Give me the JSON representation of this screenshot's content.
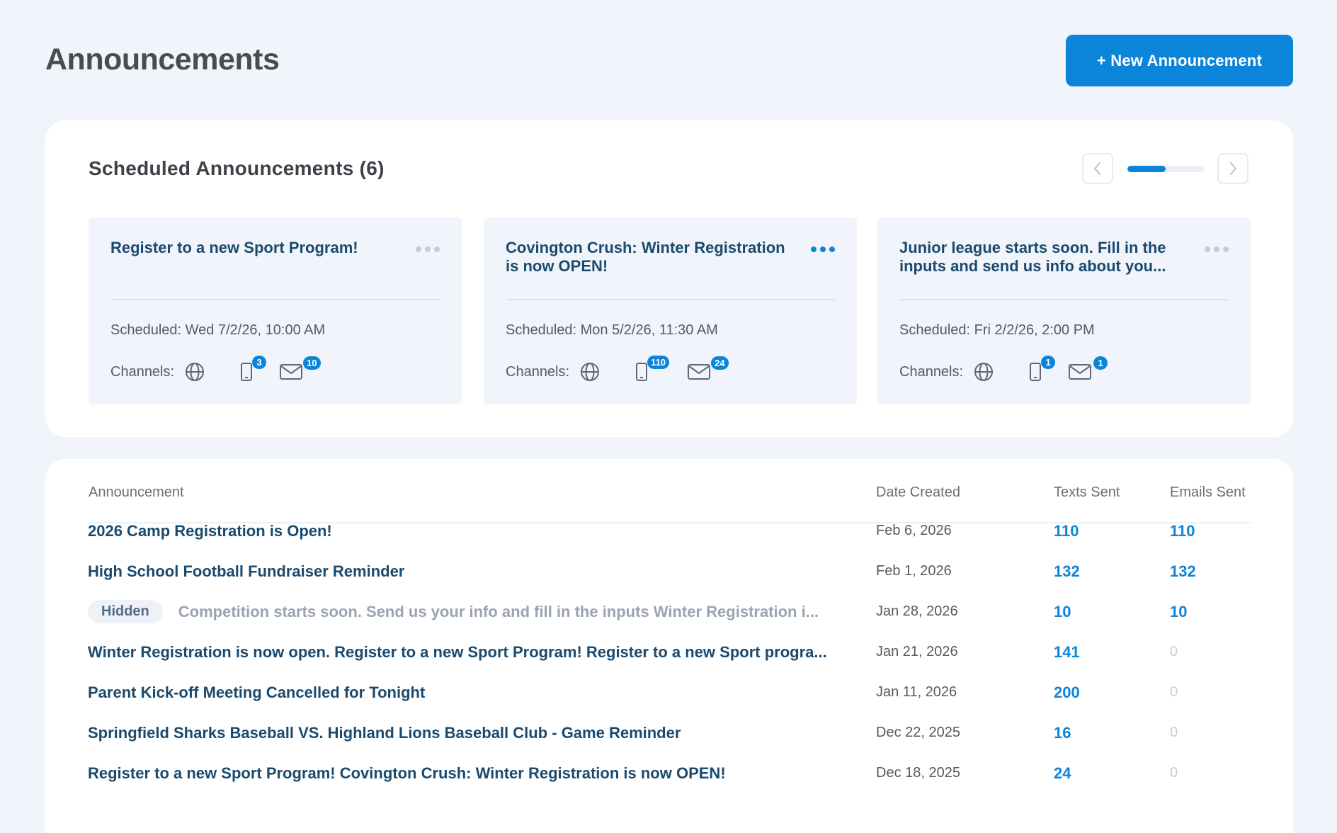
{
  "header": {
    "title": "Announcements",
    "new_button_label": "+ New Announcement"
  },
  "scheduled": {
    "title": "Scheduled Announcements (6)",
    "pager_progress": 0.5,
    "channels_label": "Channels:",
    "cards": [
      {
        "title": "Register to a new Sport Program!",
        "scheduled": "Scheduled: Wed 7/2/26, 10:00 AM",
        "menu_active": false,
        "texts_badge": "3",
        "emails_badge": "10"
      },
      {
        "title": "Covington Crush: Winter Registration is now OPEN!",
        "scheduled": "Scheduled: Mon 5/2/26, 11:30 AM",
        "menu_active": true,
        "texts_badge": "110",
        "emails_badge": "24"
      },
      {
        "title": "Junior league starts soon. Fill in the inputs and send us info about you...",
        "scheduled": "Scheduled: Fri 2/2/26, 2:00 PM",
        "menu_active": false,
        "texts_badge": "1",
        "emails_badge": "1"
      }
    ]
  },
  "table": {
    "columns": {
      "announcement": "Announcement",
      "date_created": "Date Created",
      "texts_sent": "Texts Sent",
      "emails_sent": "Emails Sent"
    },
    "hidden_label": "Hidden",
    "rows": [
      {
        "title": "2026 Camp Registration is Open!",
        "hidden": false,
        "date": "Feb 6, 2026",
        "texts": "110",
        "emails": "110"
      },
      {
        "title": "High School Football Fundraiser Reminder",
        "hidden": false,
        "date": "Feb 1, 2026",
        "texts": "132",
        "emails": "132"
      },
      {
        "title": "Competition starts soon. Send us your info and fill in the inputs Winter Registration i...",
        "hidden": true,
        "date": "Jan 28, 2026",
        "texts": "10",
        "emails": "10"
      },
      {
        "title": "Winter Registration is now open. Register to a new Sport Program! Register to a new Sport progra...",
        "hidden": false,
        "date": "Jan 21, 2026",
        "texts": "141",
        "emails": "0"
      },
      {
        "title": "Parent Kick-off Meeting Cancelled for Tonight",
        "hidden": false,
        "date": "Jan 11, 2026",
        "texts": "200",
        "emails": "0"
      },
      {
        "title": "Springfield Sharks Baseball VS. Highland Lions Baseball Club - Game Reminder",
        "hidden": false,
        "date": "Dec 22, 2025",
        "texts": "16",
        "emails": "0"
      },
      {
        "title": "Register to a new Sport Program! Covington Crush: Winter Registration is now OPEN!",
        "hidden": false,
        "date": "Dec 18, 2025",
        "texts": "24",
        "emails": "0"
      }
    ]
  },
  "colors": {
    "accent": "#0a85d9",
    "title_text": "#1a4a6e",
    "background": "#f1f4fb"
  },
  "icons": [
    "globe-icon",
    "phone-icon",
    "mail-icon",
    "chevron-left-icon",
    "chevron-right-icon",
    "more-icon"
  ]
}
